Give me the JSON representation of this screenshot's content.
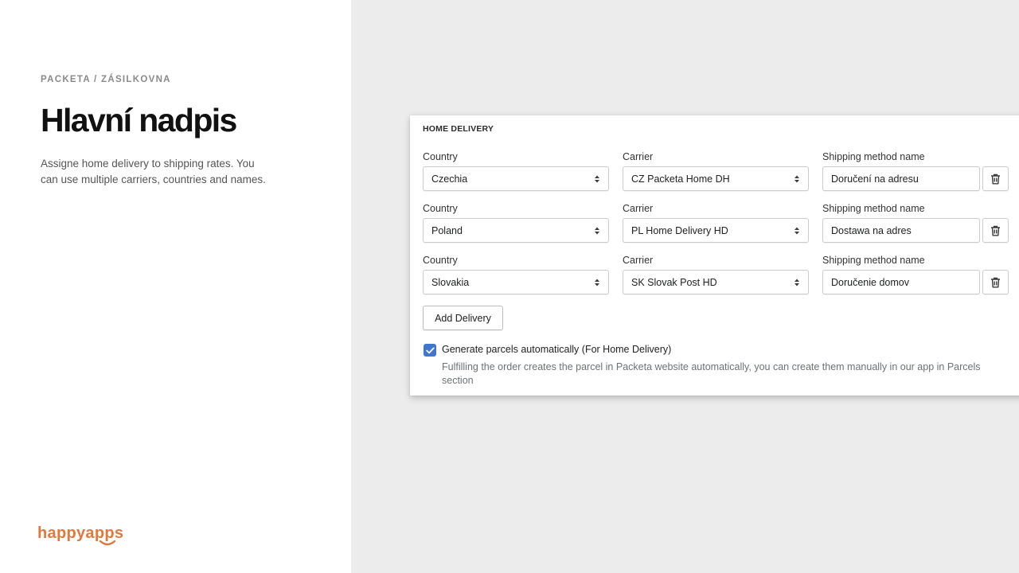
{
  "intro": {
    "eyebrow": "PACKETA / ZÁSILKOVNA",
    "title": "Hlavní nadpis",
    "description": "Assigne home delivery to shipping rates. You can use multiple carriers, countries and names."
  },
  "logo": {
    "text": "happyapps"
  },
  "card": {
    "title": "HOME DELIVERY",
    "labels": {
      "country": "Country",
      "carrier": "Carrier",
      "method": "Shipping method name"
    },
    "rows": [
      {
        "country": "Czechia",
        "carrier": "CZ Packeta Home DH",
        "method": "Doručení na adresu"
      },
      {
        "country": "Poland",
        "carrier": "PL Home Delivery HD",
        "method": "Dostawa na adres"
      },
      {
        "country": "Slovakia",
        "carrier": "SK Slovak Post HD",
        "method": "Doručenie domov"
      }
    ],
    "add_label": "Add Delivery",
    "auto": {
      "checked": true,
      "label": "Generate parcels automatically (For Home Delivery)",
      "help": "Fulfilling the order creates the parcel in Packeta website automatically, you can create them manually in our app in Parcels section"
    }
  },
  "colors": {
    "brand": "#e07a3c",
    "checkbox": "#3f76d0",
    "backdrop": "#ececec"
  },
  "icons": {
    "select": "select-arrows-icon",
    "delete": "trash-icon",
    "check": "check-icon",
    "logo": "smile-icon"
  }
}
